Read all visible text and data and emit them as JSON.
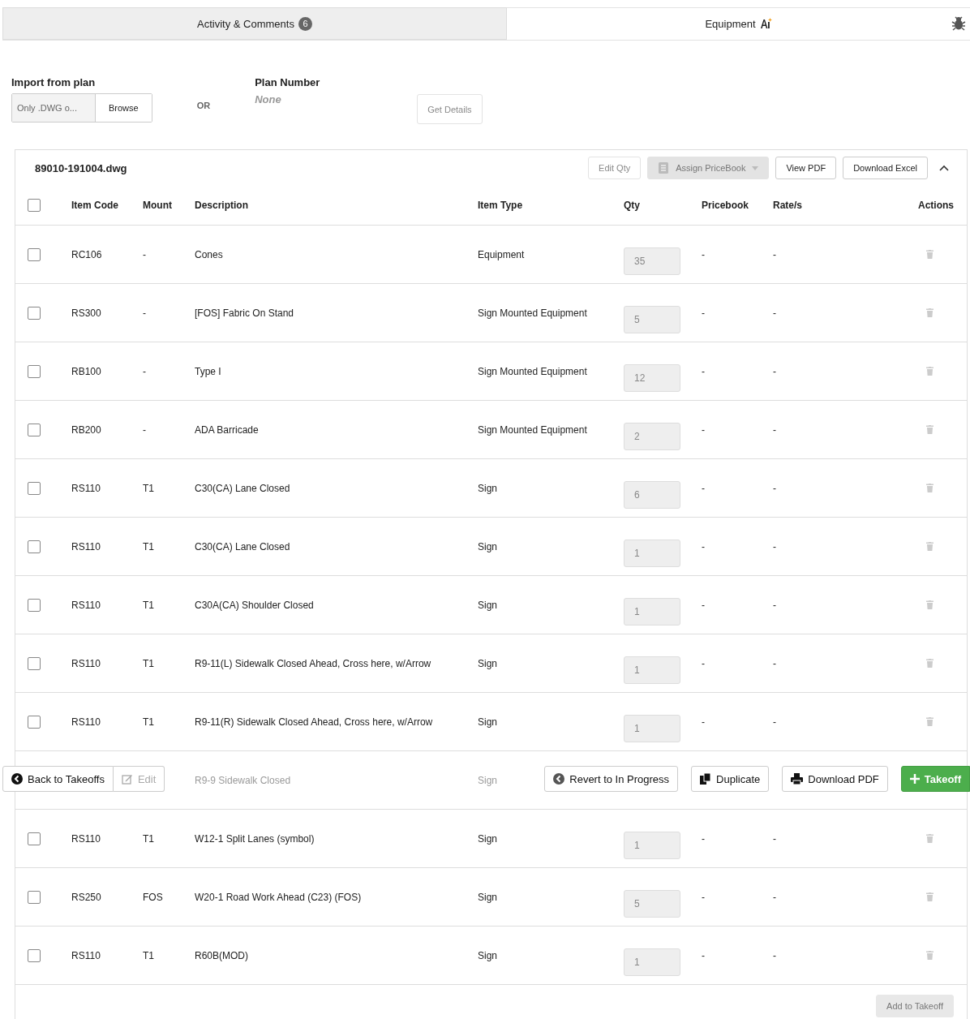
{
  "tabs": [
    {
      "label": "Activity & Comments",
      "badge": "6",
      "selected": false
    },
    {
      "label": "Equipment",
      "selected": true
    }
  ],
  "import": {
    "label": "Import from plan",
    "file_placeholder": "Only .DWG o...",
    "browse": "Browse",
    "or_label": "OR",
    "plan_number_label": "Plan Number",
    "plan_number_value": "None",
    "get_details": {
      "label": "Get Details",
      "disabled": true
    }
  },
  "file_panel": {
    "filename": "89010-191004.dwg",
    "buttons": [
      {
        "label": "Edit Qty",
        "kind": "plain",
        "disabled": true
      },
      {
        "label": "Assign PriceBook",
        "kind": "dropdown",
        "disabled": true
      },
      {
        "label": "View PDF",
        "kind": "plain",
        "disabled": false
      },
      {
        "label": "Download Excel",
        "kind": "plain",
        "disabled": false
      }
    ],
    "expanded": true,
    "select_all_checked": false,
    "columns": [
      "Item Code",
      "Mount",
      "Description",
      "Item Type",
      "Qty",
      "Pricebook",
      "Rate/s",
      "Actions"
    ],
    "rows": [
      {
        "code": "RC106",
        "mount": "-",
        "description": "Cones",
        "item_type": "Equipment",
        "qty": "35",
        "pricebook": "-",
        "rate": "-",
        "checked": false
      },
      {
        "code": "RS300",
        "mount": "-",
        "description": "[FOS] Fabric On Stand",
        "item_type": "Sign Mounted Equipment",
        "qty": "5",
        "pricebook": "-",
        "rate": "-",
        "checked": false
      },
      {
        "code": "RB100",
        "mount": "-",
        "description": "Type I",
        "item_type": "Sign Mounted Equipment",
        "qty": "12",
        "pricebook": "-",
        "rate": "-",
        "checked": false
      },
      {
        "code": "RB200",
        "mount": "-",
        "description": "ADA Barricade",
        "item_type": "Sign Mounted Equipment",
        "qty": "2",
        "pricebook": "-",
        "rate": "-",
        "checked": false
      },
      {
        "code": "RS110",
        "mount": "T1",
        "description": "C30(CA) Lane Closed",
        "item_type": "Sign",
        "qty": "6",
        "pricebook": "-",
        "rate": "-",
        "checked": false
      },
      {
        "code": "RS110",
        "mount": "T1",
        "description": "C30(CA) Lane Closed",
        "item_type": "Sign",
        "qty": "1",
        "pricebook": "-",
        "rate": "-",
        "checked": false
      },
      {
        "code": "RS110",
        "mount": "T1",
        "description": "C30A(CA) Shoulder Closed",
        "item_type": "Sign",
        "qty": "1",
        "pricebook": "-",
        "rate": "-",
        "checked": false
      },
      {
        "code": "RS110",
        "mount": "T1",
        "description": "R9-11(L) Sidewalk Closed Ahead, Cross here, w/Arrow",
        "item_type": "Sign",
        "qty": "1",
        "pricebook": "-",
        "rate": "-",
        "checked": false
      },
      {
        "code": "RS110",
        "mount": "T1",
        "description": "R9-11(R) Sidewalk Closed Ahead, Cross here, w/Arrow",
        "item_type": "Sign",
        "qty": "1",
        "pricebook": "-",
        "rate": "-",
        "checked": false
      },
      {
        "kind": "covered",
        "description": "R9-9 Sidewalk Closed",
        "item_type": "Sign"
      },
      {
        "code": "RS110",
        "mount": "T1",
        "description": "W12-1 Split Lanes (symbol)",
        "item_type": "Sign",
        "qty": "1",
        "pricebook": "-",
        "rate": "-",
        "checked": false
      },
      {
        "code": "RS250",
        "mount": "FOS",
        "description": "W20-1 Road Work Ahead (C23) (FOS)",
        "item_type": "Sign",
        "qty": "5",
        "pricebook": "-",
        "rate": "-",
        "checked": false
      },
      {
        "code": "RS110",
        "mount": "T1",
        "description": "R60B(MOD)",
        "item_type": "Sign",
        "qty": "1",
        "pricebook": "-",
        "rate": "-",
        "checked": false
      }
    ],
    "add_button": {
      "label": "Add to Takeoff",
      "disabled": true
    }
  },
  "toolbar": {
    "back": "Back to Takeoffs",
    "edit": {
      "label": "Edit",
      "disabled": true
    },
    "revert": "Revert to In Progress",
    "duplicate": "Duplicate",
    "download_pdf": "Download PDF",
    "takeoff": "Takeoff"
  }
}
